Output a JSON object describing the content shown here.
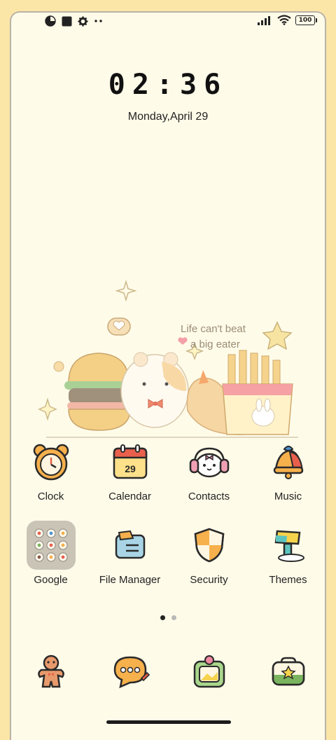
{
  "status_bar": {
    "left_icons": [
      "pie-chart-icon",
      "square-icon",
      "gear-icon",
      "more-dots-icon"
    ],
    "right_icons": [
      "signal-icon",
      "wifi-icon",
      "battery-icon"
    ],
    "battery_level": "100"
  },
  "lockscreen": {
    "time": "02:36",
    "date": "Monday,April 29"
  },
  "wallpaper": {
    "text_line1": "Life can't beat",
    "text_line2": "a big eater"
  },
  "apps": [
    {
      "label": "Clock",
      "icon": "bear-alarm-clock-icon"
    },
    {
      "label": "Calendar",
      "icon": "calendar-icon",
      "badge": "29"
    },
    {
      "label": "Contacts",
      "icon": "bunny-headphones-icon"
    },
    {
      "label": "Music",
      "icon": "bell-music-icon"
    },
    {
      "label": "Google",
      "icon": "google-folder-icon"
    },
    {
      "label": "File Manager",
      "icon": "file-manager-icon"
    },
    {
      "label": "Security",
      "icon": "shield-icon"
    },
    {
      "label": "Themes",
      "icon": "paint-roller-icon"
    }
  ],
  "pages": {
    "total": 2,
    "current": 1
  },
  "dock": [
    {
      "icon": "gingerbread-phone-icon"
    },
    {
      "icon": "message-bubble-icon"
    },
    {
      "icon": "gallery-icon"
    },
    {
      "icon": "camera-bag-icon"
    }
  ],
  "colors": {
    "background_outer": "#fbe6a8",
    "screen": "#fffbe9",
    "text": "#222222"
  }
}
